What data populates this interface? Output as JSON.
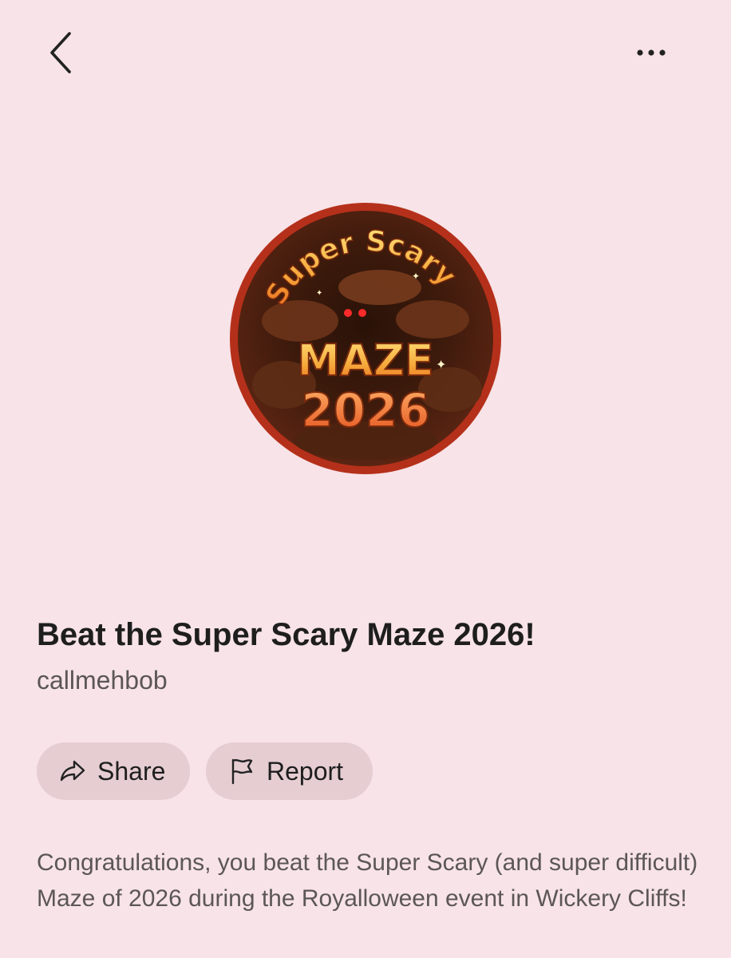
{
  "header": {
    "back_icon": "chevron-left-icon",
    "more_icon": "more-horizontal-icon"
  },
  "badge": {
    "image_text_line1": "Super Scary",
    "image_text_line2": "MAZE",
    "image_text_line3": "2026",
    "ring_color": "#b5301a"
  },
  "item": {
    "title": "Beat the Super Scary Maze 2026!",
    "creator": "callmehbob"
  },
  "actions": {
    "share_label": "Share",
    "share_icon": "share-arrow-icon",
    "report_label": "Report",
    "report_icon": "flag-icon"
  },
  "description": "Congratulations, you beat the Super Scary (and super difficult) Maze of 2026 during the Royalloween event in Wickery Cliffs!",
  "colors": {
    "background": "#f7e3e8",
    "pill_background": "#e5cdd2",
    "title_text": "#1e1e1e",
    "secondary_text": "#5c5658"
  }
}
